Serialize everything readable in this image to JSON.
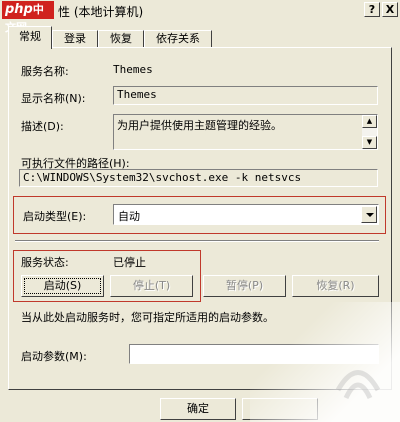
{
  "titlebar": {
    "logo_text": "php",
    "logo_suffix": "中文网",
    "title": "性 (本地计算机)",
    "help_glyph": "?",
    "close_glyph": "X"
  },
  "tabs": [
    {
      "label": "常规"
    },
    {
      "label": "登录"
    },
    {
      "label": "恢复"
    },
    {
      "label": "依存关系"
    }
  ],
  "general": {
    "service_name_label": "服务名称:",
    "service_name_value": "Themes",
    "display_name_label": "显示名称(N):",
    "display_name_value": "Themes",
    "description_label": "描述(D):",
    "description_value": "为用户提供使用主题管理的经验。",
    "exe_path_label": "可执行文件的路径(H):",
    "exe_path_value": "C:\\WINDOWS\\System32\\svchost.exe -k netsvcs",
    "startup_type_label": "启动类型(E):",
    "startup_type_value": "自动",
    "service_status_label": "服务状态:",
    "service_status_value": "已停止",
    "buttons": {
      "start": "启动(S)",
      "stop": "停止(T)",
      "pause": "暂停(P)",
      "resume": "恢复(R)"
    },
    "hint_text": "当从此处启动服务时，您可指定所适用的启动参数。",
    "start_params_label": "启动参数(M):",
    "start_params_value": ""
  },
  "footer": {
    "ok": "确定",
    "cancel": ""
  },
  "colors": {
    "dialog_bg": "#ece9d8",
    "highlight_box": "#c0392b",
    "logo_bg": "#d0221e"
  }
}
